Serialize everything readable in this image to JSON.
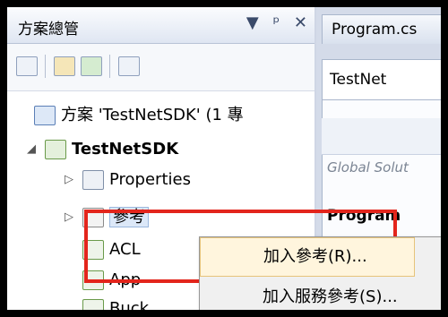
{
  "solution_explorer": {
    "title": "方案總管",
    "title_icons": [
      "▼",
      "ᵖ",
      "✕"
    ],
    "toolbar": [
      "properties-icon",
      "show-all-files-icon",
      "refresh-icon",
      "view-code-icon"
    ],
    "solution_label": "方案 'TestNetSDK' (1 專",
    "project_label": "TestNetSDK",
    "items": {
      "properties": "Properties",
      "references": "參考",
      "acl": "ACL",
      "app": "App",
      "bucket": "Buck"
    }
  },
  "editor": {
    "tab_program": "Program.cs",
    "testnet_box": "TestNet",
    "global_text": "Global Solut",
    "program_bold": "Program"
  },
  "context_menu": {
    "add_reference": "加入參考(R)...",
    "add_service_reference": "加入服務參考(S)..."
  },
  "colors": {
    "highlight_border": "#e3251c",
    "menu_hover": "#fff5dd"
  }
}
